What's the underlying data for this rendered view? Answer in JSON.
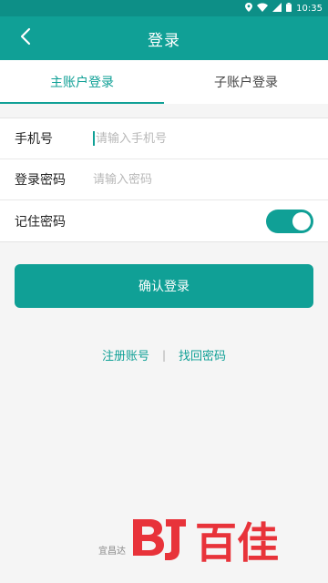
{
  "status_bar": {
    "time": "10:35",
    "icons": [
      "location-icon",
      "wifi-icon",
      "signal-icon",
      "battery-icon"
    ]
  },
  "app_bar": {
    "title": "登录",
    "back_icon": "chevron-left-icon"
  },
  "tabs": [
    {
      "label": "主账户登录",
      "active": true
    },
    {
      "label": "子账户登录",
      "active": false
    }
  ],
  "form": {
    "phone": {
      "label": "手机号",
      "placeholder": "请输入手机号",
      "value": ""
    },
    "password": {
      "label": "登录密码",
      "placeholder": "请输入密码",
      "value": ""
    },
    "remember": {
      "label": "记住密码",
      "checked": true
    }
  },
  "confirm_label": "确认登录",
  "links": {
    "register": "注册账号",
    "separator": "|",
    "recover": "找回密码"
  },
  "footer_text": "宜昌达",
  "watermark_text": "百佳",
  "colors": {
    "primary": "#10a096",
    "status_bar": "#0d8f87",
    "watermark": "#e8333a"
  }
}
